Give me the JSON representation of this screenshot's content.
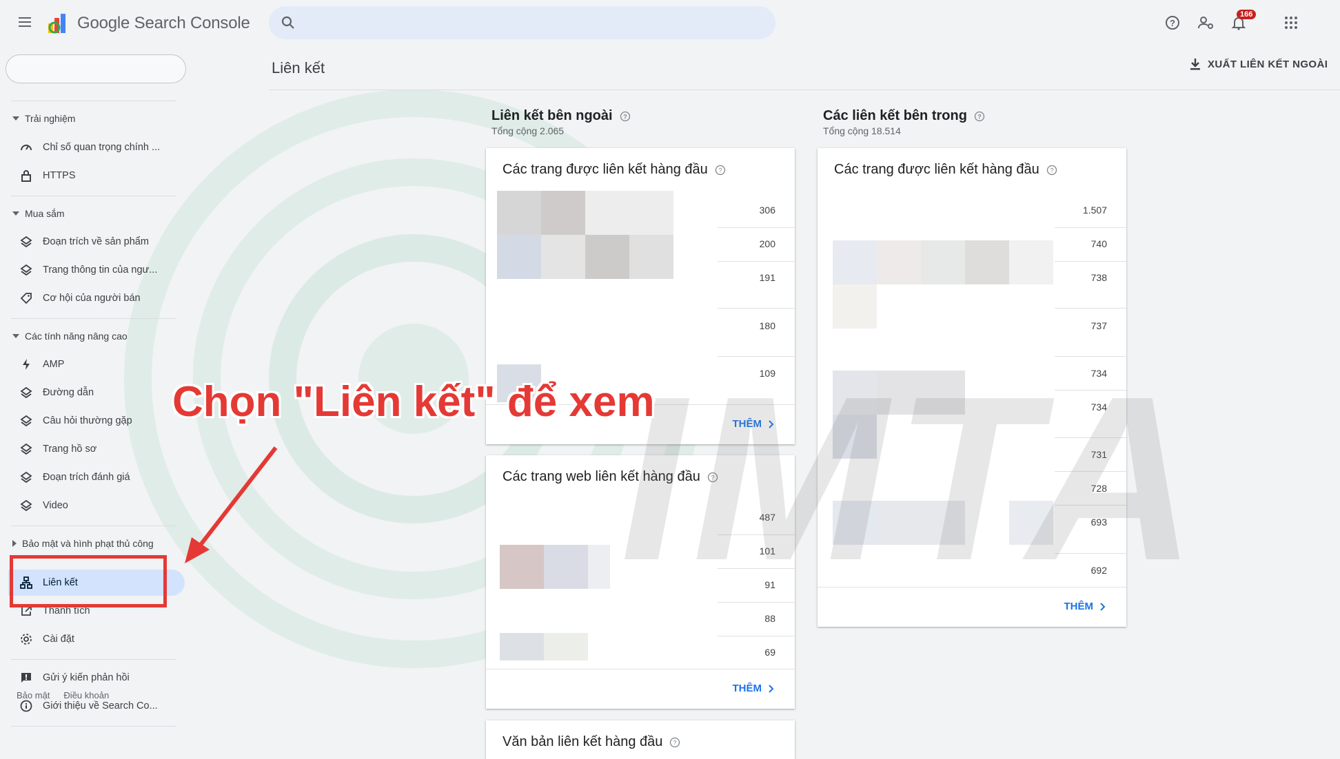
{
  "app": {
    "title": "Google Search Console"
  },
  "search": {
    "placeholder": ""
  },
  "topbar": {
    "notifications_count": "166"
  },
  "sidebar": {
    "sections": [
      {
        "label": "Trải nghiệm",
        "items": [
          {
            "label": "Chỉ số quan trọng chính ...",
            "icon": "speedometer-icon"
          },
          {
            "label": "HTTPS",
            "icon": "lock-icon"
          }
        ]
      },
      {
        "label": "Mua sắm",
        "items": [
          {
            "label": "Đoạn trích về sản phẩm",
            "icon": "layers-icon"
          },
          {
            "label": "Trang thông tin của ngư...",
            "icon": "layers-icon"
          },
          {
            "label": "Cơ hội của người bán",
            "icon": "tag-icon"
          }
        ]
      },
      {
        "label": "Các tính năng nâng cao",
        "items": [
          {
            "label": "AMP",
            "icon": "bolt-icon"
          },
          {
            "label": "Đường dẫn",
            "icon": "layers-icon"
          },
          {
            "label": "Câu hỏi thường gặp",
            "icon": "layers-icon"
          },
          {
            "label": "Trang hồ sơ",
            "icon": "layers-icon"
          },
          {
            "label": "Đoạn trích đánh giá",
            "icon": "layers-icon"
          },
          {
            "label": "Video",
            "icon": "layers-icon"
          }
        ]
      },
      {
        "label": "Bảo mật và hình phạt thủ công"
      }
    ],
    "links": {
      "label": "Liên kết",
      "icon": "sitemap-icon"
    },
    "achievements": {
      "label": "Thành tích",
      "icon": "external-link-icon"
    },
    "settings": {
      "label": "Cài đặt",
      "icon": "gear-icon"
    },
    "feedback": {
      "label": "Gửi ý kiến phản hồi",
      "icon": "feedback-icon"
    },
    "about": {
      "label": "Giới thiệu về Search Co...",
      "icon": "info-icon"
    },
    "footer": {
      "privacy": "Bảo mật",
      "terms": "Điều khoản"
    }
  },
  "page": {
    "title": "Liên kết",
    "export_label": "XUẤT LIÊN KẾT NGOÀI"
  },
  "external": {
    "title": "Liên kết bên ngoài",
    "total": "Tổng cộng 2.065",
    "top_linked_pages": {
      "title": "Các trang được liên kết hàng đầu",
      "values": [
        "306",
        "200",
        "191",
        "180",
        "109"
      ],
      "more": "THÊM"
    },
    "top_linking_sites": {
      "title": "Các trang web liên kết hàng đầu",
      "values": [
        "487",
        "101",
        "91",
        "88",
        "69"
      ],
      "more": "THÊM"
    },
    "top_anchor_text": {
      "title": "Văn bản liên kết hàng đầu"
    }
  },
  "internal": {
    "title": "Các liên kết bên trong",
    "total": "Tổng cộng 18.514",
    "top_linked_pages": {
      "title": "Các trang được liên kết hàng đầu",
      "values": [
        "1.507",
        "740",
        "738",
        "737",
        "734",
        "734",
        "731",
        "728",
        "693",
        "692"
      ],
      "more": "THÊM"
    }
  },
  "overlay": {
    "annotation": "Chọn \"Liên kết\" để xem",
    "watermark": "IMTA",
    "highlight_color": "#e53935"
  },
  "colors": {
    "accent": "#1a73e8",
    "active_nav": "#d3e3fd",
    "search_bg": "#e3ebf8"
  }
}
